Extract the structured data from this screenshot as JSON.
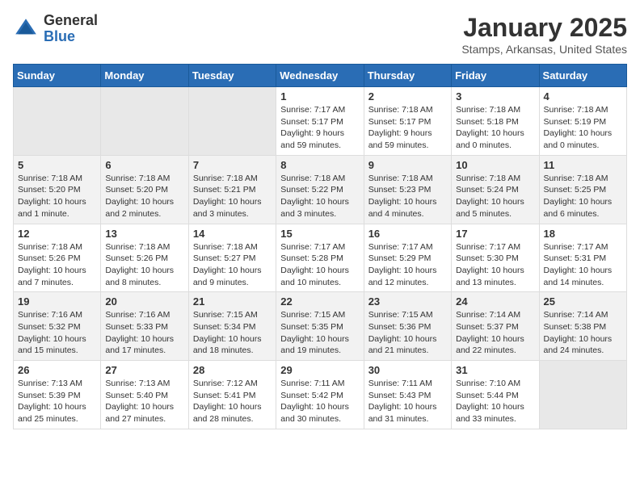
{
  "logo": {
    "general": "General",
    "blue": "Blue"
  },
  "title": {
    "month": "January 2025",
    "location": "Stamps, Arkansas, United States"
  },
  "weekdays": [
    "Sunday",
    "Monday",
    "Tuesday",
    "Wednesday",
    "Thursday",
    "Friday",
    "Saturday"
  ],
  "weeks": [
    [
      {
        "day": "",
        "empty": true
      },
      {
        "day": "",
        "empty": true
      },
      {
        "day": "",
        "empty": true
      },
      {
        "day": "1",
        "sunrise": "7:17 AM",
        "sunset": "5:17 PM",
        "daylight": "9 hours and 59 minutes."
      },
      {
        "day": "2",
        "sunrise": "7:18 AM",
        "sunset": "5:17 PM",
        "daylight": "9 hours and 59 minutes."
      },
      {
        "day": "3",
        "sunrise": "7:18 AM",
        "sunset": "5:18 PM",
        "daylight": "10 hours and 0 minutes."
      },
      {
        "day": "4",
        "sunrise": "7:18 AM",
        "sunset": "5:19 PM",
        "daylight": "10 hours and 0 minutes."
      }
    ],
    [
      {
        "day": "5",
        "sunrise": "7:18 AM",
        "sunset": "5:20 PM",
        "daylight": "10 hours and 1 minute."
      },
      {
        "day": "6",
        "sunrise": "7:18 AM",
        "sunset": "5:20 PM",
        "daylight": "10 hours and 2 minutes."
      },
      {
        "day": "7",
        "sunrise": "7:18 AM",
        "sunset": "5:21 PM",
        "daylight": "10 hours and 3 minutes."
      },
      {
        "day": "8",
        "sunrise": "7:18 AM",
        "sunset": "5:22 PM",
        "daylight": "10 hours and 3 minutes."
      },
      {
        "day": "9",
        "sunrise": "7:18 AM",
        "sunset": "5:23 PM",
        "daylight": "10 hours and 4 minutes."
      },
      {
        "day": "10",
        "sunrise": "7:18 AM",
        "sunset": "5:24 PM",
        "daylight": "10 hours and 5 minutes."
      },
      {
        "day": "11",
        "sunrise": "7:18 AM",
        "sunset": "5:25 PM",
        "daylight": "10 hours and 6 minutes."
      }
    ],
    [
      {
        "day": "12",
        "sunrise": "7:18 AM",
        "sunset": "5:26 PM",
        "daylight": "10 hours and 7 minutes."
      },
      {
        "day": "13",
        "sunrise": "7:18 AM",
        "sunset": "5:26 PM",
        "daylight": "10 hours and 8 minutes."
      },
      {
        "day": "14",
        "sunrise": "7:18 AM",
        "sunset": "5:27 PM",
        "daylight": "10 hours and 9 minutes."
      },
      {
        "day": "15",
        "sunrise": "7:17 AM",
        "sunset": "5:28 PM",
        "daylight": "10 hours and 10 minutes."
      },
      {
        "day": "16",
        "sunrise": "7:17 AM",
        "sunset": "5:29 PM",
        "daylight": "10 hours and 12 minutes."
      },
      {
        "day": "17",
        "sunrise": "7:17 AM",
        "sunset": "5:30 PM",
        "daylight": "10 hours and 13 minutes."
      },
      {
        "day": "18",
        "sunrise": "7:17 AM",
        "sunset": "5:31 PM",
        "daylight": "10 hours and 14 minutes."
      }
    ],
    [
      {
        "day": "19",
        "sunrise": "7:16 AM",
        "sunset": "5:32 PM",
        "daylight": "10 hours and 15 minutes."
      },
      {
        "day": "20",
        "sunrise": "7:16 AM",
        "sunset": "5:33 PM",
        "daylight": "10 hours and 17 minutes."
      },
      {
        "day": "21",
        "sunrise": "7:15 AM",
        "sunset": "5:34 PM",
        "daylight": "10 hours and 18 minutes."
      },
      {
        "day": "22",
        "sunrise": "7:15 AM",
        "sunset": "5:35 PM",
        "daylight": "10 hours and 19 minutes."
      },
      {
        "day": "23",
        "sunrise": "7:15 AM",
        "sunset": "5:36 PM",
        "daylight": "10 hours and 21 minutes."
      },
      {
        "day": "24",
        "sunrise": "7:14 AM",
        "sunset": "5:37 PM",
        "daylight": "10 hours and 22 minutes."
      },
      {
        "day": "25",
        "sunrise": "7:14 AM",
        "sunset": "5:38 PM",
        "daylight": "10 hours and 24 minutes."
      }
    ],
    [
      {
        "day": "26",
        "sunrise": "7:13 AM",
        "sunset": "5:39 PM",
        "daylight": "10 hours and 25 minutes."
      },
      {
        "day": "27",
        "sunrise": "7:13 AM",
        "sunset": "5:40 PM",
        "daylight": "10 hours and 27 minutes."
      },
      {
        "day": "28",
        "sunrise": "7:12 AM",
        "sunset": "5:41 PM",
        "daylight": "10 hours and 28 minutes."
      },
      {
        "day": "29",
        "sunrise": "7:11 AM",
        "sunset": "5:42 PM",
        "daylight": "10 hours and 30 minutes."
      },
      {
        "day": "30",
        "sunrise": "7:11 AM",
        "sunset": "5:43 PM",
        "daylight": "10 hours and 31 minutes."
      },
      {
        "day": "31",
        "sunrise": "7:10 AM",
        "sunset": "5:44 PM",
        "daylight": "10 hours and 33 minutes."
      },
      {
        "day": "",
        "empty": true
      }
    ]
  ]
}
